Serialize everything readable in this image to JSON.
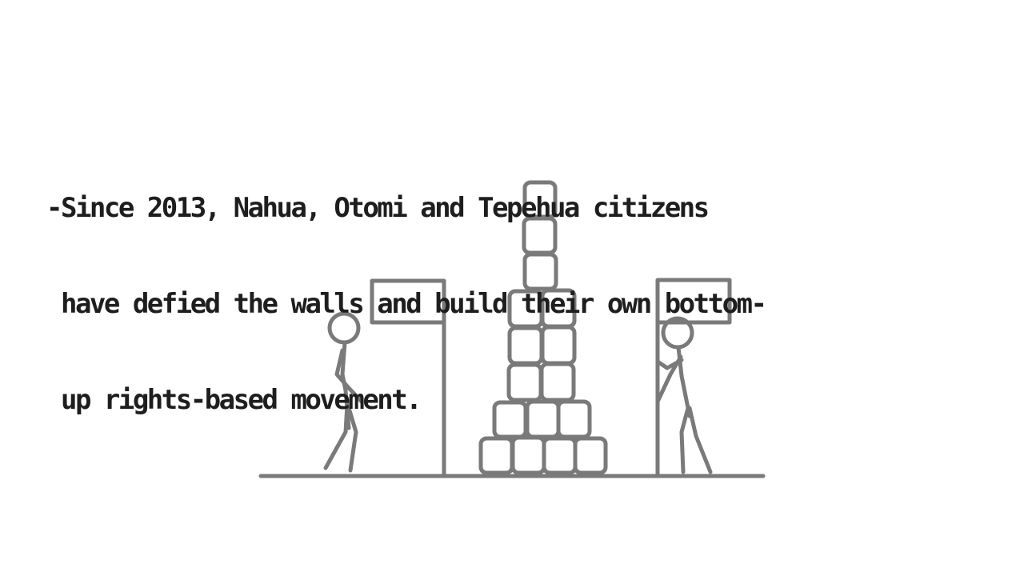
{
  "caption": {
    "lines": [
      "-Since 2013, Nahua, Otomi and Tepehua citizens",
      " have defied the walls and build their own bottom-",
      " up rights-based movement."
    ]
  },
  "colors": {
    "background": "#ffffff",
    "ink": "#7a7a7a",
    "text": "#1e1e1e"
  },
  "scene": {
    "left_flag": "flag-on-pole",
    "right_flag": "flag-on-pole",
    "left_figure": "stick-figure-standing",
    "right_figure": "stick-figure-holding-pole",
    "tower": "stacked-blocks-tower"
  }
}
